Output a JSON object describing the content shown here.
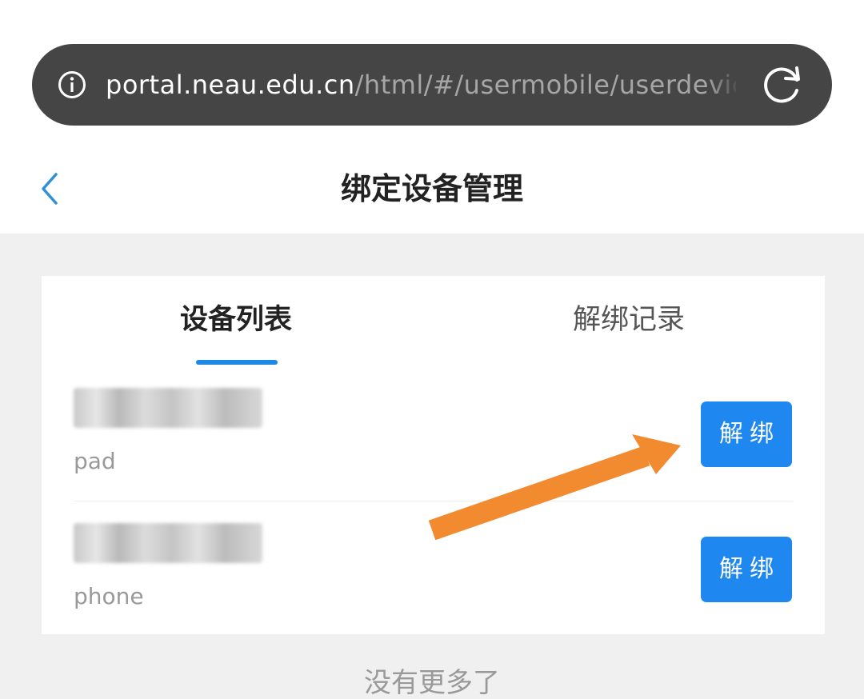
{
  "browser": {
    "url_host": "portal.neau.edu.cn",
    "url_path": "/html/#/usermobile/userdevic",
    "info_icon": "info-circle-icon",
    "reload_icon": "reload-icon"
  },
  "header": {
    "title": "绑定设备管理",
    "back_icon": "chevron-left-icon"
  },
  "tabs": [
    {
      "label": "设备列表",
      "active": true
    },
    {
      "label": "解绑记录",
      "active": false
    }
  ],
  "devices": [
    {
      "type": "pad",
      "unbind_label": "解绑"
    },
    {
      "type": "phone",
      "unbind_label": "解绑"
    }
  ],
  "footer": {
    "no_more": "没有更多了"
  },
  "colors": {
    "accent": "#1e88e5",
    "button": "#1e88f0",
    "annotation_arrow": "#f28a30"
  }
}
